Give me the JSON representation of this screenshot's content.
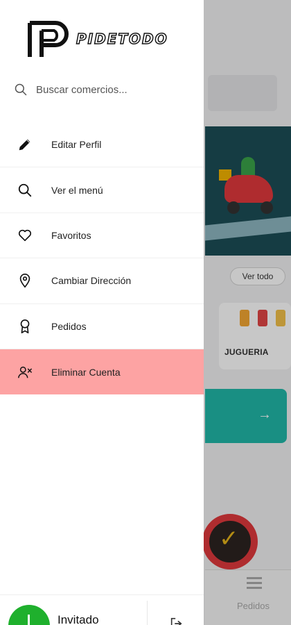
{
  "brand": {
    "name": "PIDETODO"
  },
  "search": {
    "placeholder": "Buscar comercios..."
  },
  "menu": {
    "items": [
      {
        "label": "Editar Perfil",
        "icon": "pencil-icon"
      },
      {
        "label": "Ver el menú",
        "icon": "search-icon"
      },
      {
        "label": "Favoritos",
        "icon": "heart-icon"
      },
      {
        "label": "Cambiar Dirección",
        "icon": "location-pin-icon"
      },
      {
        "label": "Pedidos",
        "icon": "award-icon"
      },
      {
        "label": "Eliminar Cuenta",
        "icon": "user-remove-icon",
        "highlighted": true
      }
    ]
  },
  "footer": {
    "user_name": "Invitado"
  },
  "background": {
    "see_all": "Ver todo",
    "category_label": "JUGUERIA",
    "tab_label": "Pedidos"
  },
  "colors": {
    "danger_highlight": "#fda3a3",
    "avatar": "#1fb02d",
    "accent_teal": "#21b8a8"
  }
}
